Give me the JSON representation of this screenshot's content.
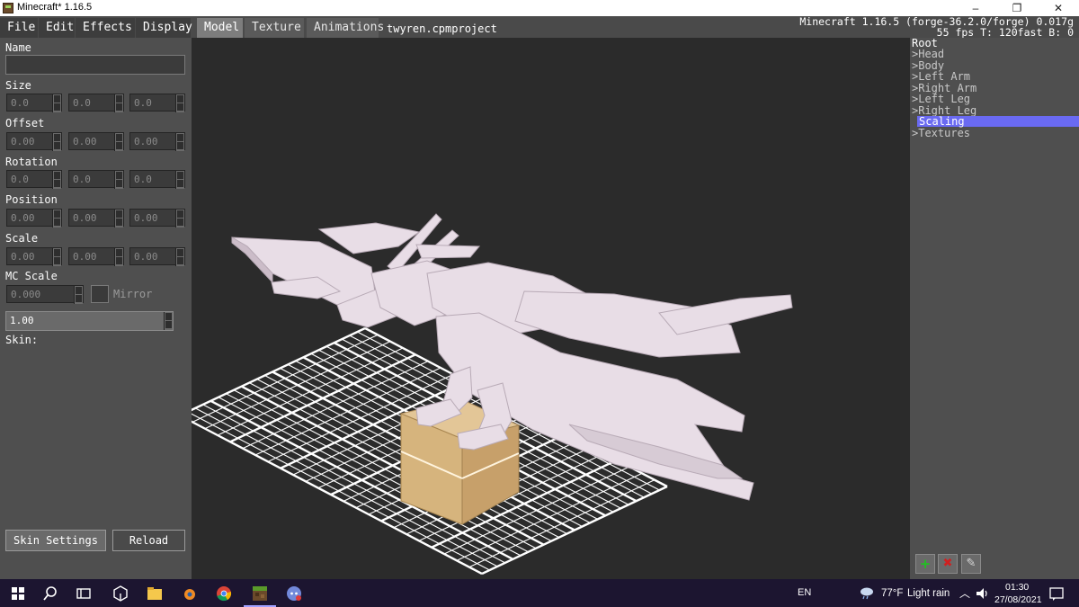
{
  "window": {
    "title": "Minecraft* 1.16.5",
    "minimize_glyph": "–",
    "maximize_glyph": "❐",
    "close_glyph": "✕"
  },
  "menu": {
    "file": "File",
    "edit": "Edit",
    "effects": "Effects",
    "display": "Display"
  },
  "tabs": {
    "model": "Model",
    "texture": "Texture",
    "animations": "Animations",
    "active": "Model"
  },
  "project_file": "twyren.cpmproject",
  "debug": {
    "line1": "Minecraft 1.16.5 (forge-36.2.0/forge) 0.017g",
    "line2": "55 fps T: 120fast B: 0"
  },
  "properties": {
    "name_label": "Name",
    "name_value": "",
    "size_label": "Size",
    "size": [
      "0.0",
      "0.0",
      "0.0"
    ],
    "offset_label": "Offset",
    "offset": [
      "0.00",
      "0.00",
      "0.00"
    ],
    "rotation_label": "Rotation",
    "rotation": [
      "0.0",
      "0.0",
      "0.0"
    ],
    "position_label": "Position",
    "position": [
      "0.00",
      "0.00",
      "0.00"
    ],
    "scale_label": "Scale",
    "scale": [
      "0.00",
      "0.00",
      "0.00"
    ],
    "mc_scale_label": "MC Scale",
    "mc_scale_value": "0.000",
    "mirror_label": "Mirror",
    "global_scale_value": "1.00",
    "skin_label": "Skin:",
    "skin_settings_button": "Skin Settings",
    "reload_button": "Reload"
  },
  "tree": {
    "root": "Root",
    "items": [
      {
        "label": "Head",
        "expand": ">"
      },
      {
        "label": "Body",
        "expand": ">"
      },
      {
        "label": "Left Arm",
        "expand": ">"
      },
      {
        "label": "Right Arm",
        "expand": ">"
      },
      {
        "label": "Left Leg",
        "expand": ">"
      },
      {
        "label": "Right Leg",
        "expand": ">"
      },
      {
        "label": "Scaling",
        "expand": "",
        "selected": true
      },
      {
        "label": "Textures",
        "expand": ">"
      }
    ]
  },
  "tree_buttons": {
    "add": "+",
    "delete": "✖",
    "edit": "✎"
  },
  "taskbar": {
    "keyboard_layout": "EN",
    "weather_temp": "77°F",
    "weather_text": "Light rain",
    "time": "01:30",
    "date": "27/08/2021"
  },
  "colors": {
    "accent_selected": "#6a6af2",
    "panel": "#4f4f4f",
    "viewport": "#2b2b2b",
    "model": "#e8dde6",
    "add_icon": "#22c022",
    "delete_icon": "#d02020"
  }
}
